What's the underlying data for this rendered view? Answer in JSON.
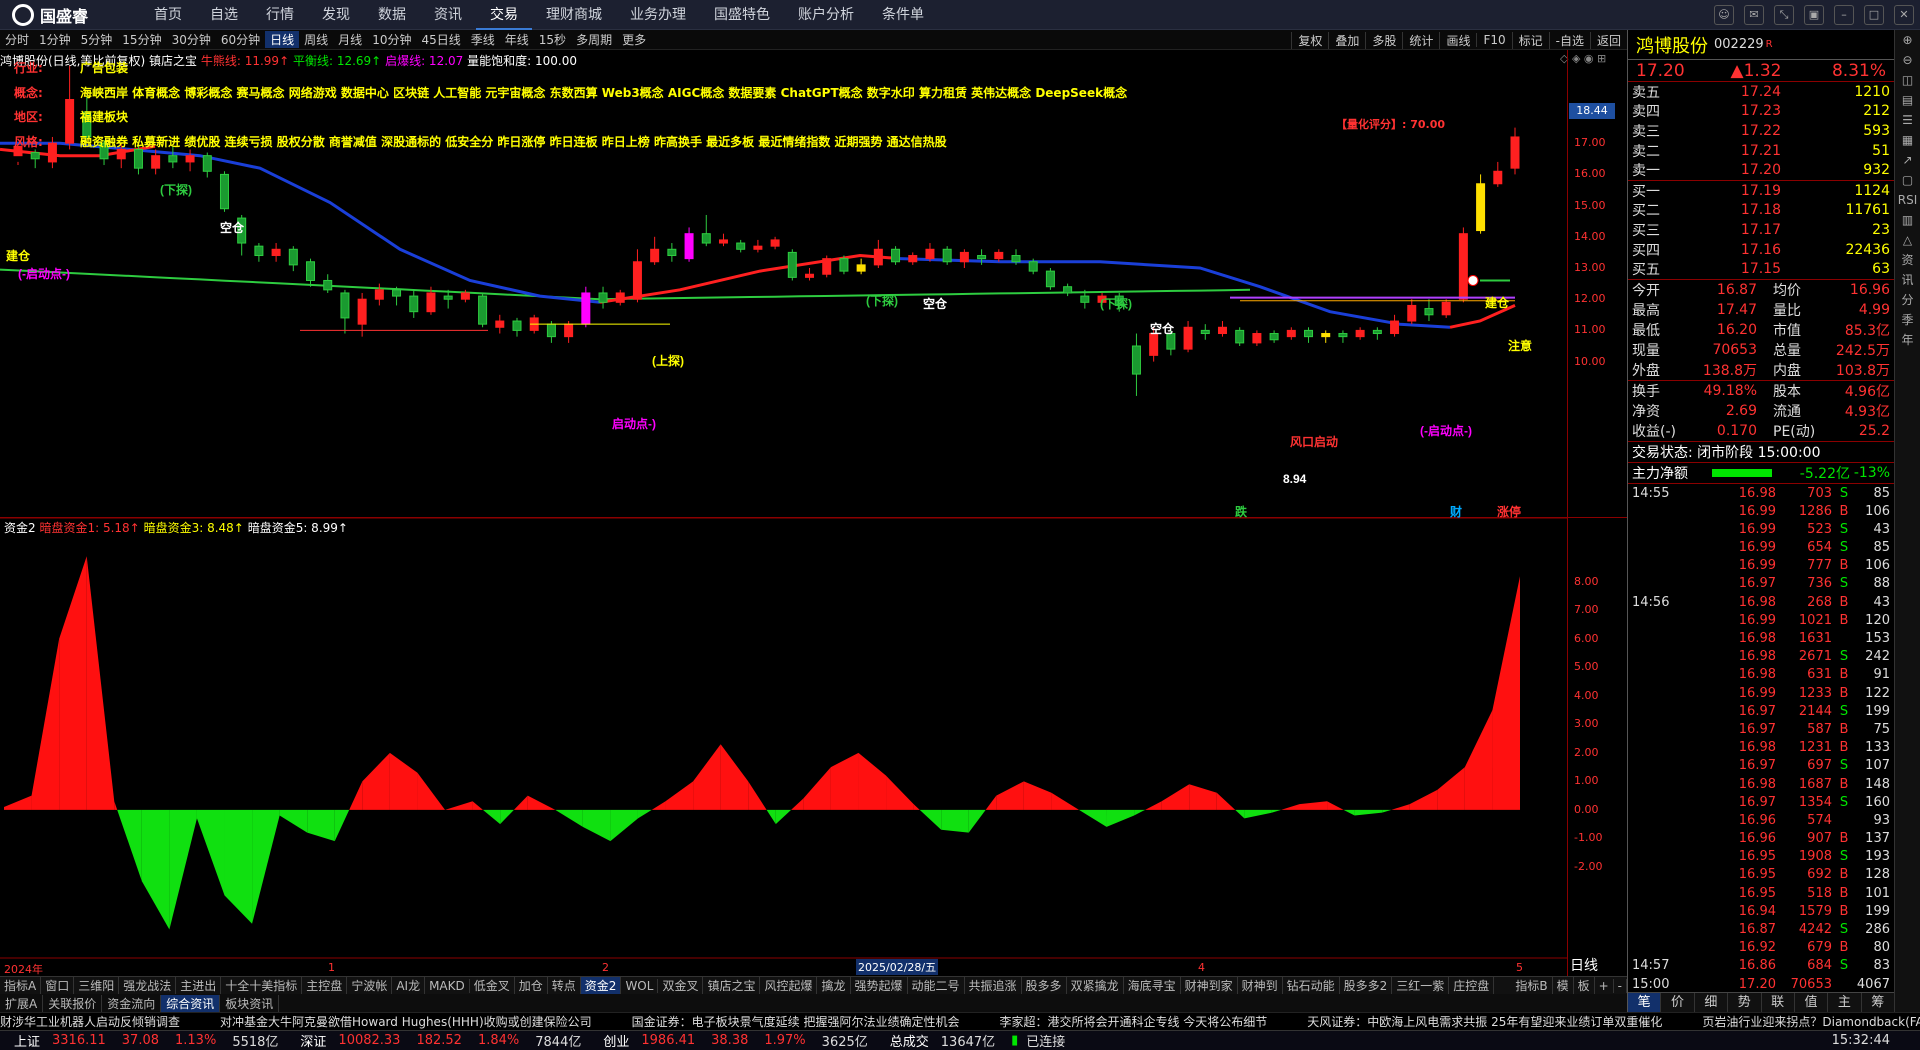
{
  "app": {
    "logo": "国盛睿",
    "menu": [
      "首页",
      "自选",
      "行情",
      "发现",
      "数据",
      "资讯",
      "交易",
      "理财商城",
      "业务办理",
      "国盛特色",
      "账户分析",
      "条件单"
    ],
    "active_menu": "交易"
  },
  "periods": [
    "分时",
    "1分钟",
    "5分钟",
    "15分钟",
    "30分钟",
    "60分钟",
    "日线",
    "周线",
    "月线",
    "10分钟",
    "45日线",
    "季线",
    "年线",
    "15秒",
    "多周期",
    "更多"
  ],
  "active_period": "日线",
  "toolbar": [
    "复权",
    "叠加",
    "多股",
    "统计",
    "画线",
    "F10",
    "标记",
    "-自选",
    "返回"
  ],
  "chart_info": {
    "name": "鸿博股份(日线,等比前复权)",
    "indicator": "镇店之宝",
    "bull_label": "牛熊线: 11.99↑",
    "balance_label": "平衡线: 12.69↑",
    "start_label": "启爆线: 12.07",
    "satur_label": "量能饱和度: 100.00"
  },
  "tags": {
    "industry_key": "行业:",
    "industry": "广告包装",
    "concept_key": "概念:",
    "concepts": "海峡西岸 体育概念 博彩概念 赛马概念 网络游戏 数据中心 区块链 人工智能 元宇宙概念 东数西算 Web3概念 AIGC概念 数据要素 ChatGPT概念 数字水印 算力租赁 英伟达概念 DeepSeek概念",
    "region_key": "地区:",
    "region": "福建板块",
    "style_key": "风格:",
    "styles": "融资融券 私募新进 绩优股 连续亏损 股权分散 商誉减值 深股通标的 低安全分 昨日涨停 昨日连板 昨日上榜 昨高换手 最近多板 最近情绪指数 近期强势 通达信热股",
    "score": "【量化评分】: 70.00"
  },
  "price_axis": [
    "18.00",
    "17.00",
    "16.00",
    "15.00",
    "14.00",
    "13.00",
    "12.00",
    "11.00",
    "10.00"
  ],
  "price_marker": "18.44",
  "annotations": {
    "low": "8.94",
    "start1": "(-启动点-)",
    "start2": "启动点-)",
    "start3": "(-启动点-)",
    "fengkou": "风口启动",
    "empty1": "空仓",
    "empty2": "空仓",
    "empty3": "空仓",
    "build": "建仓",
    "zhuyi": "注意",
    "xiatan": "(下探)",
    "shangtan": "(上探)",
    "die": "跌",
    "cai": "财",
    "zhangting": "涨停"
  },
  "sub_info": {
    "name": "资金2",
    "l1": "暗盘资金1: 5.18↑",
    "l3": "暗盘资金3: 8.48↑",
    "l5": "暗盘资金5: 8.99↑"
  },
  "sub_axis": [
    "8.00",
    "7.00",
    "6.00",
    "5.00",
    "4.00",
    "3.00",
    "2.00",
    "1.00",
    "0.00",
    "-1.00",
    "-2.00"
  ],
  "dates": {
    "y": "2024年",
    "m1": "1",
    "m2": "2",
    "sel": "2025/02/28/五",
    "m4": "4",
    "m5": "5",
    "type": "日线"
  },
  "chart_data": {
    "type": "line",
    "series": [
      {
        "name": "暗盘资金1",
        "values": [
          0.1,
          0.5,
          6,
          8.9,
          0.3,
          -2.5,
          -4.2,
          -0.3,
          -3,
          -4,
          -0.2,
          -0.8,
          -1.1,
          1,
          2,
          1.3,
          0,
          0.3,
          -0.5,
          0.5,
          0,
          -0.6,
          -1.1,
          -0.3,
          0.3,
          1,
          2.3,
          1,
          -0.5,
          0.4,
          1.5,
          2,
          1.2,
          0.2,
          -0.7,
          -0.8,
          0.5,
          1,
          0.6,
          0,
          -0.6,
          -0.2,
          0.3,
          0.9,
          0.6,
          -0.3,
          -0.1,
          0.2,
          0.3,
          -0.2,
          -0.1,
          0.2,
          0.7,
          1.5,
          3.5,
          8.2
        ],
        "ylim": [
          -5.2,
          9.4
        ]
      }
    ]
  },
  "bottom_tabs": [
    "指标A",
    "窗口",
    "三维阳",
    "强龙战法",
    "主进出",
    "十全十美指标",
    "主控盘",
    "宁波帐",
    "AI龙",
    "MAKD",
    "低金叉",
    "加仓",
    "转点",
    "资金2",
    "WOL",
    "双金叉",
    "镇店之宝",
    "风控起爆",
    "擒龙",
    "强势起爆",
    "动能二号",
    "共振追涨",
    "股多多",
    "双紧擒龙",
    "海底寻宝",
    "财神到家",
    "财神到",
    "钻石动能",
    "股多多2",
    "三红一紫",
    "庄控盘"
  ],
  "bottom_active": "资金2",
  "bottom_right": [
    "指标B",
    "模",
    "板",
    "+",
    "-"
  ],
  "bottom_tabs2": [
    "扩展A",
    "关联报价",
    "资金流向",
    "综合资讯",
    "板块资讯"
  ],
  "bottom_active2": "综合资讯",
  "ticker": [
    "财涉华工业机器人启动反倾销调查",
    "对冲基金大牛阿克曼欲借Howard Hughes(HHH)收购或创建保险公司",
    "国金证券：电子板块景气度延续 把握强阿尔法业绩确定性机会",
    "李家超：港交所将会开通科企专线 今天将公布细节",
    "天风证券：中欧海上风电需求共振 25年有望迎来业绩订单双重催化",
    "页岩油行业迎来拐点？Diamondback(FANG)"
  ],
  "status": {
    "sh_label": "上证",
    "sh": "3316.11",
    "sh_chg": "37.08",
    "sh_pct": "1.13%",
    "sh_amt": "5518亿",
    "sz_label": "深证",
    "sz": "10082.33",
    "sz_chg": "182.52",
    "sz_pct": "1.84%",
    "sz_amt": "7844亿",
    "cy_label": "创业",
    "cy": "1986.41",
    "cy_chg": "38.38",
    "cy_pct": "1.97%",
    "cy_amt": "3625亿",
    "total_label": "总成交",
    "total": "13647亿",
    "conn": "已连接",
    "time": "15:32:44"
  },
  "quote": {
    "name": "鸿博股份",
    "code": "002229",
    "flag": "R",
    "price": "17.20",
    "chg": "▲1.32",
    "pct": "8.31%",
    "asks": [
      [
        "卖五",
        "17.24",
        "1210"
      ],
      [
        "卖四",
        "17.23",
        "212"
      ],
      [
        "卖三",
        "17.22",
        "593"
      ],
      [
        "卖二",
        "17.21",
        "51"
      ],
      [
        "卖一",
        "17.20",
        "932"
      ]
    ],
    "bids": [
      [
        "买一",
        "17.19",
        "1124"
      ],
      [
        "买二",
        "17.18",
        "11761"
      ],
      [
        "买三",
        "17.17",
        "23"
      ],
      [
        "买四",
        "17.16",
        "22436"
      ],
      [
        "买五",
        "17.15",
        "63"
      ]
    ],
    "stats": [
      [
        "今开",
        "16.87",
        "均价",
        "16.96"
      ],
      [
        "最高",
        "17.47",
        "量比",
        "4.99"
      ],
      [
        "最低",
        "16.20",
        "市值",
        "85.3亿"
      ],
      [
        "现量",
        "70653",
        "总量",
        "242.5万"
      ],
      [
        "外盘",
        "138.8万",
        "内盘",
        "103.8万"
      ]
    ],
    "stats2": [
      [
        "换手",
        "49.18%",
        "股本",
        "4.96亿"
      ],
      [
        "净资",
        "2.69",
        "流通",
        "4.93亿"
      ],
      [
        "收益(-)",
        "0.170",
        "PE(动)",
        "25.2"
      ]
    ],
    "state": "交易状态: 闭市阶段 15:00:00",
    "main_label": "主力净额",
    "main_val": "-5.22亿",
    "main_pct": "-13%"
  },
  "ticks": [
    [
      "14:55",
      "16.98",
      "703",
      "S",
      "85"
    ],
    [
      "",
      "16.99",
      "1286",
      "B",
      "106"
    ],
    [
      "",
      "16.99",
      "523",
      "S",
      "43"
    ],
    [
      "",
      "16.99",
      "654",
      "S",
      "85"
    ],
    [
      "",
      "16.99",
      "777",
      "B",
      "106"
    ],
    [
      "",
      "16.97",
      "736",
      "S",
      "88"
    ],
    [
      "14:56",
      "16.98",
      "268",
      "B",
      "43"
    ],
    [
      "",
      "16.99",
      "1021",
      "B",
      "120"
    ],
    [
      "",
      "16.98",
      "1631",
      "",
      "153"
    ],
    [
      "",
      "16.98",
      "2671",
      "S",
      "242"
    ],
    [
      "",
      "16.98",
      "631",
      "B",
      "91"
    ],
    [
      "",
      "16.99",
      "1233",
      "B",
      "122"
    ],
    [
      "",
      "16.97",
      "2144",
      "S",
      "199"
    ],
    [
      "",
      "16.97",
      "587",
      "B",
      "75"
    ],
    [
      "",
      "16.98",
      "1231",
      "B",
      "133"
    ],
    [
      "",
      "16.97",
      "697",
      "S",
      "107"
    ],
    [
      "",
      "16.98",
      "1687",
      "B",
      "148"
    ],
    [
      "",
      "16.97",
      "1354",
      "S",
      "160"
    ],
    [
      "",
      "16.96",
      "574",
      "",
      "93"
    ],
    [
      "",
      "16.96",
      "907",
      "B",
      "137"
    ],
    [
      "",
      "16.95",
      "1908",
      "S",
      "193"
    ],
    [
      "",
      "16.95",
      "692",
      "B",
      "128"
    ],
    [
      "",
      "16.95",
      "518",
      "B",
      "101"
    ],
    [
      "",
      "16.94",
      "1579",
      "B",
      "199"
    ],
    [
      "",
      "16.87",
      "4242",
      "S",
      "286"
    ],
    [
      "",
      "16.92",
      "679",
      "B",
      "80"
    ],
    [
      "14:57",
      "16.86",
      "684",
      "S",
      "83"
    ],
    [
      "15:00",
      "17.20",
      "70653",
      "",
      "4067"
    ]
  ],
  "right_tabs": [
    "笔",
    "价",
    "细",
    "势",
    "联",
    "值",
    "主",
    "筹"
  ],
  "side_icons": [
    "⊕",
    "⊖",
    "◫",
    "▤",
    "☰",
    "▦",
    "↗",
    "▢",
    "RSI",
    "▥",
    "△",
    "资",
    "讯",
    "分",
    "季",
    "年"
  ],
  "colors": {
    "up": "#ff3232",
    "down": "#00e600",
    "accent": "#3a7bd5"
  }
}
